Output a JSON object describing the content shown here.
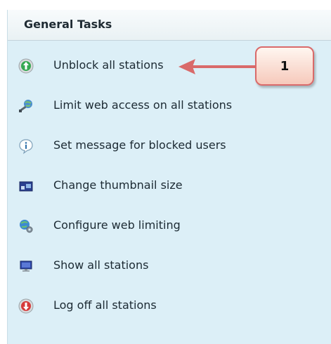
{
  "panel": {
    "title": "General Tasks"
  },
  "tasks": [
    {
      "label": "Unblock all stations",
      "icon": "unblock-green-circle-icon"
    },
    {
      "label": "Limit web access on all stations",
      "icon": "limit-web-access-icon"
    },
    {
      "label": "Set message for blocked users",
      "icon": "info-message-icon"
    },
    {
      "label": "Change thumbnail size",
      "icon": "thumbnail-size-icon"
    },
    {
      "label": "Configure web limiting",
      "icon": "configure-globe-gear-icon"
    },
    {
      "label": "Show all stations",
      "icon": "monitor-icon"
    },
    {
      "label": "Log off all stations",
      "icon": "logoff-red-circle-icon"
    }
  ],
  "callout": {
    "number": "1",
    "color": "#d96a6a"
  },
  "colors": {
    "panel_bg": "#dceff7",
    "header_bg": "#eef4f6",
    "arrow": "#d96a6a"
  }
}
